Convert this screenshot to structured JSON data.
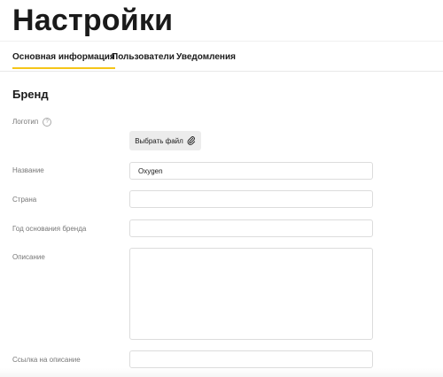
{
  "page": {
    "title": "Настройки"
  },
  "tabs": [
    {
      "label": "Основная информация",
      "active": true
    },
    {
      "label": "Пользователи",
      "active": false
    },
    {
      "label": "Уведомления",
      "active": false
    }
  ],
  "section": {
    "title": "Бренд"
  },
  "fields": {
    "logo": {
      "label": "Логотип",
      "help_icon": "question-icon",
      "button_label": "Выбрать файл",
      "button_icon": "paperclip-icon"
    },
    "name": {
      "label": "Название",
      "value": "Oxygen"
    },
    "country": {
      "label": "Страна",
      "value": ""
    },
    "founded": {
      "label": "Год основания бренда",
      "value": ""
    },
    "description": {
      "label": "Описание",
      "value": ""
    },
    "description_link": {
      "label": "Ссылка на описание",
      "value": ""
    }
  },
  "colors": {
    "accent": "#f5c518",
    "button_bg": "#ececec",
    "border": "#dcdcdc"
  }
}
